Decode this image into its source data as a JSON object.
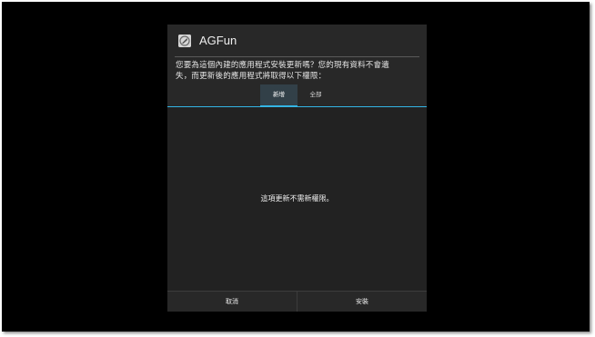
{
  "dialog": {
    "title": "AGFun",
    "app_icon": "agfun-app-icon",
    "message_line1": "您要為這個內建的應用程式安裝更新嗎？您的現有資料不會遺",
    "message_line2": "失，而更新後的應用程式將取得以下權限：",
    "tabs": [
      {
        "label": "新增",
        "selected": true
      },
      {
        "label": "全部",
        "selected": false
      }
    ],
    "empty_message": "這項更新不需新權限。",
    "buttons": {
      "cancel": "取消",
      "install": "安裝"
    }
  },
  "colors": {
    "accent": "#33b5e5",
    "dialog_background": "#282828",
    "screen_background": "#000000"
  }
}
